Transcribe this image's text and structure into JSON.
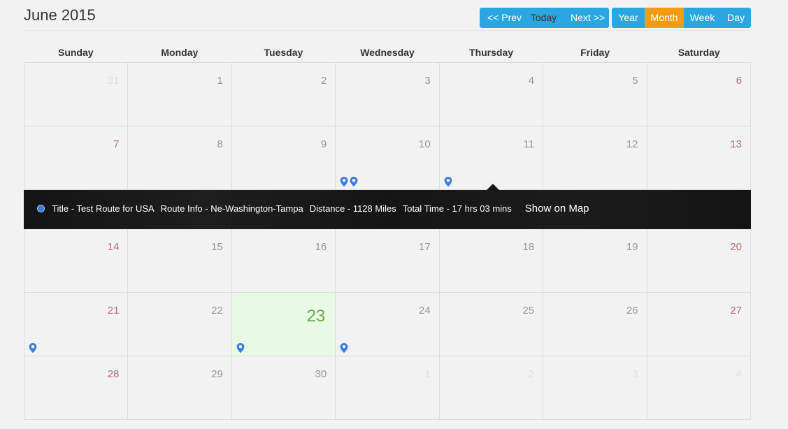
{
  "header": {
    "title": "June 2015",
    "nav": [
      "<< Prev",
      "Today",
      "Next >>"
    ],
    "views": [
      "Year",
      "Month",
      "Week",
      "Day"
    ],
    "active_view": "Month"
  },
  "weekdays": [
    "Sunday",
    "Monday",
    "Tuesday",
    "Wednesday",
    "Thursday",
    "Friday",
    "Saturday"
  ],
  "weeks": [
    [
      "31",
      "1",
      "2",
      "3",
      "4",
      "5",
      "6"
    ],
    [
      "7",
      "8",
      "9",
      "10",
      "11",
      "12",
      "13"
    ],
    [
      "14",
      "15",
      "16",
      "17",
      "18",
      "19",
      "20"
    ],
    [
      "21",
      "22",
      "23",
      "24",
      "25",
      "26",
      "27"
    ],
    [
      "28",
      "29",
      "30",
      "1",
      "2",
      "3",
      "4"
    ]
  ],
  "event_details": {
    "title": "Title - Test Route for USA",
    "route": "Route Info - Ne-Washington-Tampa",
    "distance": "Distance - 1128 Miles",
    "time": "Total Time - 17 hrs 03 mins",
    "action": "Show on Map"
  },
  "colors": {
    "accent": "#2aa6e0",
    "active": "#f39c12",
    "today_bg": "#e8fae6",
    "pin": "#3b7ddd"
  }
}
